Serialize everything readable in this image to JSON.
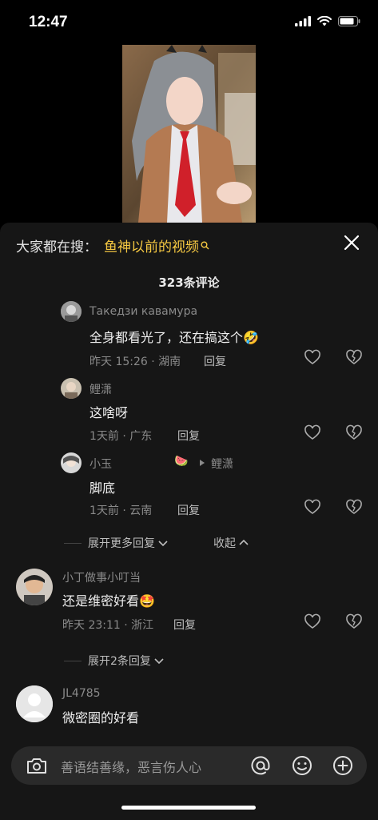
{
  "status": {
    "time": "12:47"
  },
  "search": {
    "prefix": "大家都在搜：",
    "term": "鱼神以前的视频"
  },
  "comments_count": "323条评论",
  "replies": [
    {
      "user": "Такедзи кавамура",
      "text": "全身都看光了，还在搞这个",
      "emoji": "🤣",
      "time": "昨天 15:26 · 湖南",
      "reply_label": "回复"
    },
    {
      "user": "鲤潇",
      "text": "这啥呀",
      "time": "1天前 · 广东",
      "reply_label": "回复"
    },
    {
      "user": "小玉",
      "emoji_after_user": "🍉",
      "reply_to": "鲤潇",
      "text": "脚底",
      "time": "1天前 · 云南",
      "reply_label": "回复"
    }
  ],
  "expand_more": "展开更多回复",
  "collapse": "收起",
  "comment2": {
    "user": "小丁做事小叮当",
    "text": "还是维密好看",
    "emoji": "🤩",
    "time": "昨天 23:11 · 浙江",
    "reply_label": "回复"
  },
  "expand_two": "展开2条回复",
  "comment3": {
    "user": "JL4785",
    "text": "微密圈的好看"
  },
  "input": {
    "placeholder": "善语结善缘，恶言伤人心"
  }
}
